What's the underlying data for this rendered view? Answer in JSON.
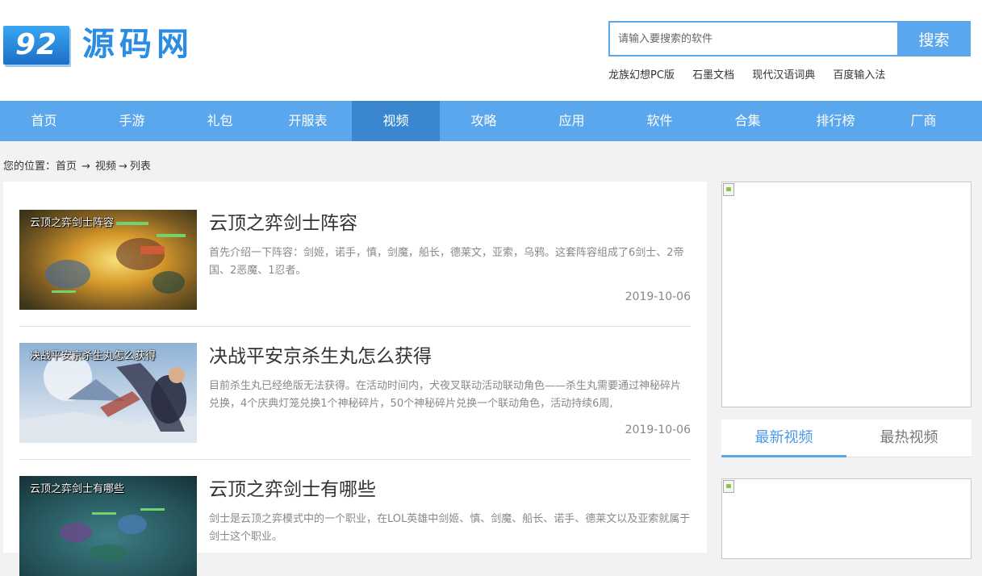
{
  "site": {
    "logo_badge": "92",
    "logo_text": "源码网"
  },
  "search": {
    "placeholder": "请输入要搜索的软件",
    "button_label": "搜索",
    "hot_links": [
      "龙族幻想PC版",
      "石墨文档",
      "现代汉语词典",
      "百度输入法"
    ]
  },
  "nav": {
    "items": [
      "首页",
      "手游",
      "礼包",
      "开服表",
      "视频",
      "攻略",
      "应用",
      "软件",
      "合集",
      "排行榜",
      "厂商"
    ],
    "active": "视频"
  },
  "breadcrumb": {
    "prefix": "您的位置：",
    "home": "首页",
    "sep": "→",
    "section": "视频",
    "current": "列表"
  },
  "articles": [
    {
      "thumb_caption": "云顶之弈剑士阵容",
      "title": "云顶之弈剑士阵容",
      "desc": "首先介绍一下阵容：剑姬，诺手，慎，剑魔，船长，德莱文，亚索，乌鸦。这套阵容组成了6剑士、2帝国、2恶魔、1忍者。",
      "date": "2019-10-06"
    },
    {
      "thumb_caption": "决战平安京杀生丸怎么获得",
      "title": "决战平安京杀生丸怎么获得",
      "desc": "目前杀生丸已经绝版无法获得。在活动时间内，犬夜叉联动活动联动角色——杀生丸需要通过神秘碎片兑换，4个庆典灯笼兑换1个神秘碎片，50个神秘碎片兑换一个联动角色，活动持续6周,",
      "date": "2019-10-06"
    },
    {
      "thumb_caption": "云顶之弈剑士有哪些",
      "title": "云顶之弈剑士有哪些",
      "desc": "剑士是云顶之弈模式中的一个职业，在LOL英雄中剑姬、慎、剑魔、船长、诺手、德莱文以及亚索就属于剑士这个职业。",
      "date": ""
    }
  ],
  "sidebar": {
    "tabs": [
      "最新视频",
      "最热视频"
    ],
    "active_tab": "最新视频"
  },
  "colors": {
    "accent": "#5aa7ee",
    "nav_active": "#3a86cf",
    "page_bg": "#f2f2f2"
  }
}
